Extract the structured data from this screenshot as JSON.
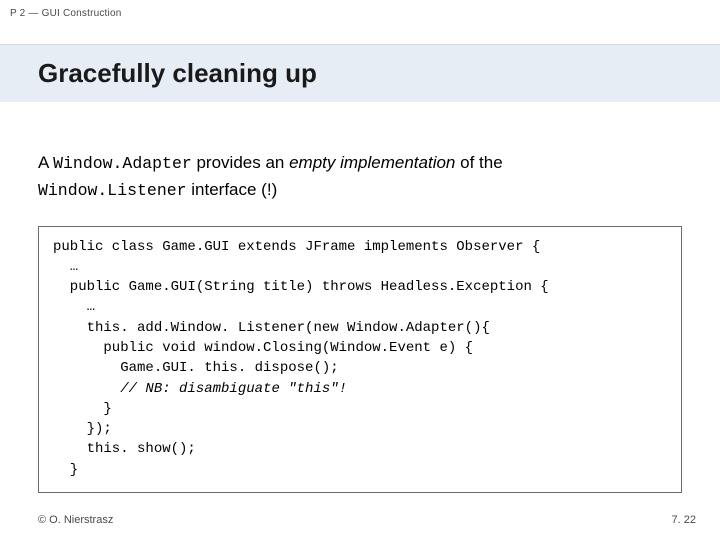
{
  "crumb": "P 2 — GUI Construction",
  "title": "Gracefully cleaning up",
  "lead": {
    "prefix": "A ",
    "code1": "Window.Adapter",
    "mid1": " provides an ",
    "em": "empty implementation",
    "mid2": " of the ",
    "code2": "Window.Listener",
    "suffix": " interface (!)"
  },
  "code": {
    "l1": "public class Game.GUI extends JFrame implements Observer {",
    "l2": "  …",
    "l3": "  public Game.GUI(String title) throws Headless.Exception {",
    "l4": "    …",
    "l5": "    this. add.Window. Listener(new Window.Adapter(){",
    "l6": "      public void window.Closing(Window.Event e) {",
    "l7": "        Game.GUI. this. dispose();",
    "l8_a": "        ",
    "l8_b": "// NB: disambiguate \"this\"!",
    "l9": "      }",
    "l10": "    });",
    "l11": "    this. show();",
    "l12": "  }"
  },
  "footer": {
    "copyright": "© O. Nierstrasz",
    "page": "7. 22"
  }
}
